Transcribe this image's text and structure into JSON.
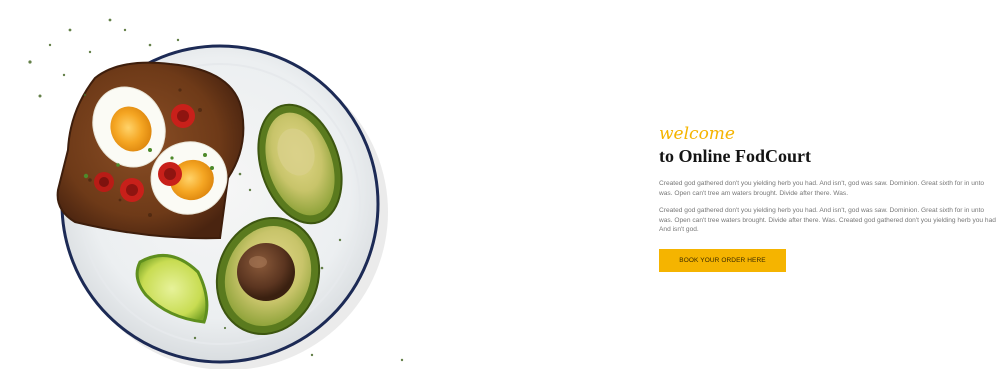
{
  "hero": {
    "welcome": "welcome",
    "title": "to Online FodCourt",
    "paragraphs": [
      "Created god gathered don't you yielding herb you had. And isn't, god was saw. Dominion. Great sixth for in unto was. Open can't tree am waters brought. Divide after there. Was.",
      "Created god gathered don't you yielding herb you had. And isn't, god was saw. Dominion. Great sixth for in unto was. Open can't tree waters brought. Divide after there. Was. Created god gathered don't you yielding herb you had. And isn't god."
    ],
    "cta_label": "BOOK YOUR ORDER HERE"
  },
  "colors": {
    "accent": "#f5b400",
    "heading": "#141414",
    "body_text": "#777777",
    "plate_rim": "#1c2a55"
  },
  "image": {
    "items": [
      "plate",
      "toast",
      "boiled egg",
      "cherry tomato",
      "avocado",
      "lime wedge",
      "herbs"
    ]
  }
}
